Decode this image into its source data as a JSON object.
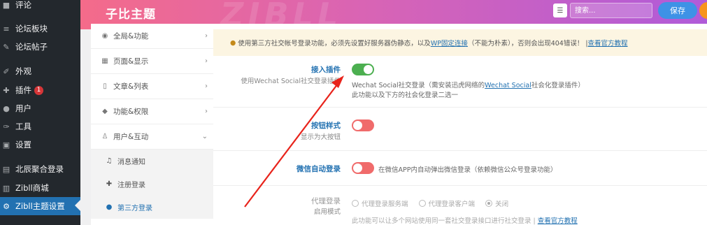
{
  "wp_sidebar": {
    "items": [
      {
        "label": "评论",
        "icon": "comment-icon"
      },
      {
        "label": "论坛板块",
        "icon": "forum-icon"
      },
      {
        "label": "论坛帖子",
        "icon": "forum-post-icon"
      },
      {
        "label": "外观",
        "icon": "brush-icon"
      },
      {
        "label": "插件",
        "icon": "plugin-icon",
        "badge": "1"
      },
      {
        "label": "用户",
        "icon": "user-icon"
      },
      {
        "label": "工具",
        "icon": "wrench-icon"
      },
      {
        "label": "设置",
        "icon": "settings-icon"
      },
      {
        "label": "北辰聚合登录",
        "icon": "login-icon"
      },
      {
        "label": "Zibll商城",
        "icon": "shop-icon"
      },
      {
        "label": "Zibll主题设置",
        "icon": "gear-icon",
        "active": true
      }
    ]
  },
  "header": {
    "title": "子比主题",
    "watermark": "ZIBLL",
    "search_placeholder": "搜索...",
    "save_label": "保存"
  },
  "options_nav": {
    "items": [
      {
        "label": "全局&功能",
        "icon": "globe-icon"
      },
      {
        "label": "页面&显示",
        "icon": "calendar-icon"
      },
      {
        "label": "文章&列表",
        "icon": "book-icon"
      },
      {
        "label": "功能&权限",
        "icon": "shield-icon"
      },
      {
        "label": "用户&互动",
        "icon": "user-icon",
        "expanded": true
      }
    ],
    "sub_items": [
      {
        "label": "消息通知",
        "icon": "bell-icon"
      },
      {
        "label": "注册登录",
        "icon": "user-plus-icon"
      },
      {
        "label": "第三方登录",
        "icon": "chat-icon",
        "active": true
      }
    ]
  },
  "notice": {
    "text1": "使用第三方社交帐号登录功能，必须先设置好服务器伪静态，以及",
    "link1": "WP固定连接",
    "text2": "（不能为朴素），否则会出现404错误！ | ",
    "link2": "查看官方教程"
  },
  "settings": {
    "plugin": {
      "label": "接入插件",
      "sublabel": "使用Wechat Social社交登录插件",
      "enabled": true,
      "desc_prefix": "Wechat Social社交登录（需安装迅虎网络的",
      "desc_link": "Wechat Social",
      "desc_suffix": "社会化登录插件）",
      "desc_line2": "此功能以及下方的社会化登录二选一"
    },
    "button_style": {
      "label": "按钮样式",
      "sublabel": "显示为大按钮",
      "enabled": false
    },
    "wechat_auto": {
      "label": "微信自动登录",
      "enabled": false,
      "desc": "在微信APP内自动弹出微信登录（依赖微信公众号登录功能）"
    },
    "proxy": {
      "label": "代理登录",
      "sublabel": "启用模式",
      "options": [
        "代理登录服务端",
        "代理登录客户端",
        "关闭"
      ],
      "selected": "关闭",
      "desc_prefix": "此功能可以让多个网站使用同一套社交登录接口进行社交登录 | ",
      "desc_link": "查看官方教程"
    }
  },
  "colors": {
    "accent": "#2271b1",
    "toggle_on": "#4caf50",
    "toggle_off": "#f06b6b",
    "annotation_arrow": "#e8231b"
  }
}
